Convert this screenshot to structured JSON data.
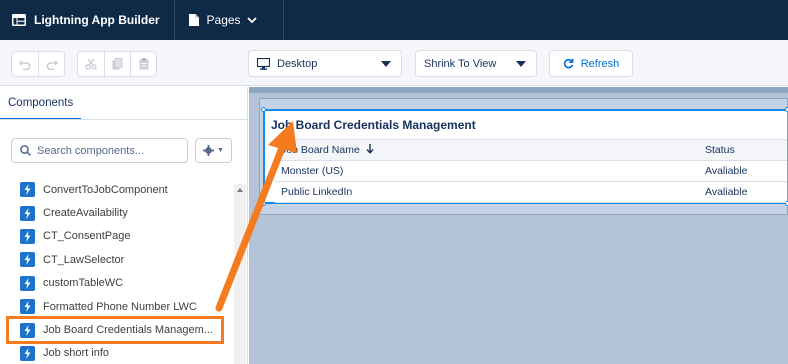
{
  "header": {
    "app_title": "Lightning App Builder",
    "pages_label": "Pages"
  },
  "toolbar": {
    "device_select": "Desktop",
    "view_select": "Shrink To View",
    "refresh_label": "Refresh"
  },
  "panel": {
    "tab_label": "Components",
    "search_placeholder": "Search components...",
    "items": [
      {
        "label": "ConvertToJobComponent"
      },
      {
        "label": "CreateAvailability"
      },
      {
        "label": "CT_ConsentPage"
      },
      {
        "label": "CT_LawSelector"
      },
      {
        "label": "customTableWC"
      },
      {
        "label": "Formatted Phone Number LWC"
      },
      {
        "label": "Job Board Credentials Managem..."
      },
      {
        "label": "Job short info"
      }
    ]
  },
  "canvas": {
    "card_title": "Job Board Credentials Management",
    "columns": [
      "Job Board Name",
      "Status"
    ],
    "rows": [
      [
        "Monster (US)",
        "Avaliable"
      ],
      [
        "Public LinkedIn",
        "Avaliable"
      ]
    ]
  },
  "colors": {
    "header_bg": "#0e2a47",
    "accent": "#0070d2",
    "selection_border": "#1589ee",
    "annotation": "#f47b20",
    "canvas_bg": "#b3c4d9",
    "component_icon": "#1d73c9"
  }
}
